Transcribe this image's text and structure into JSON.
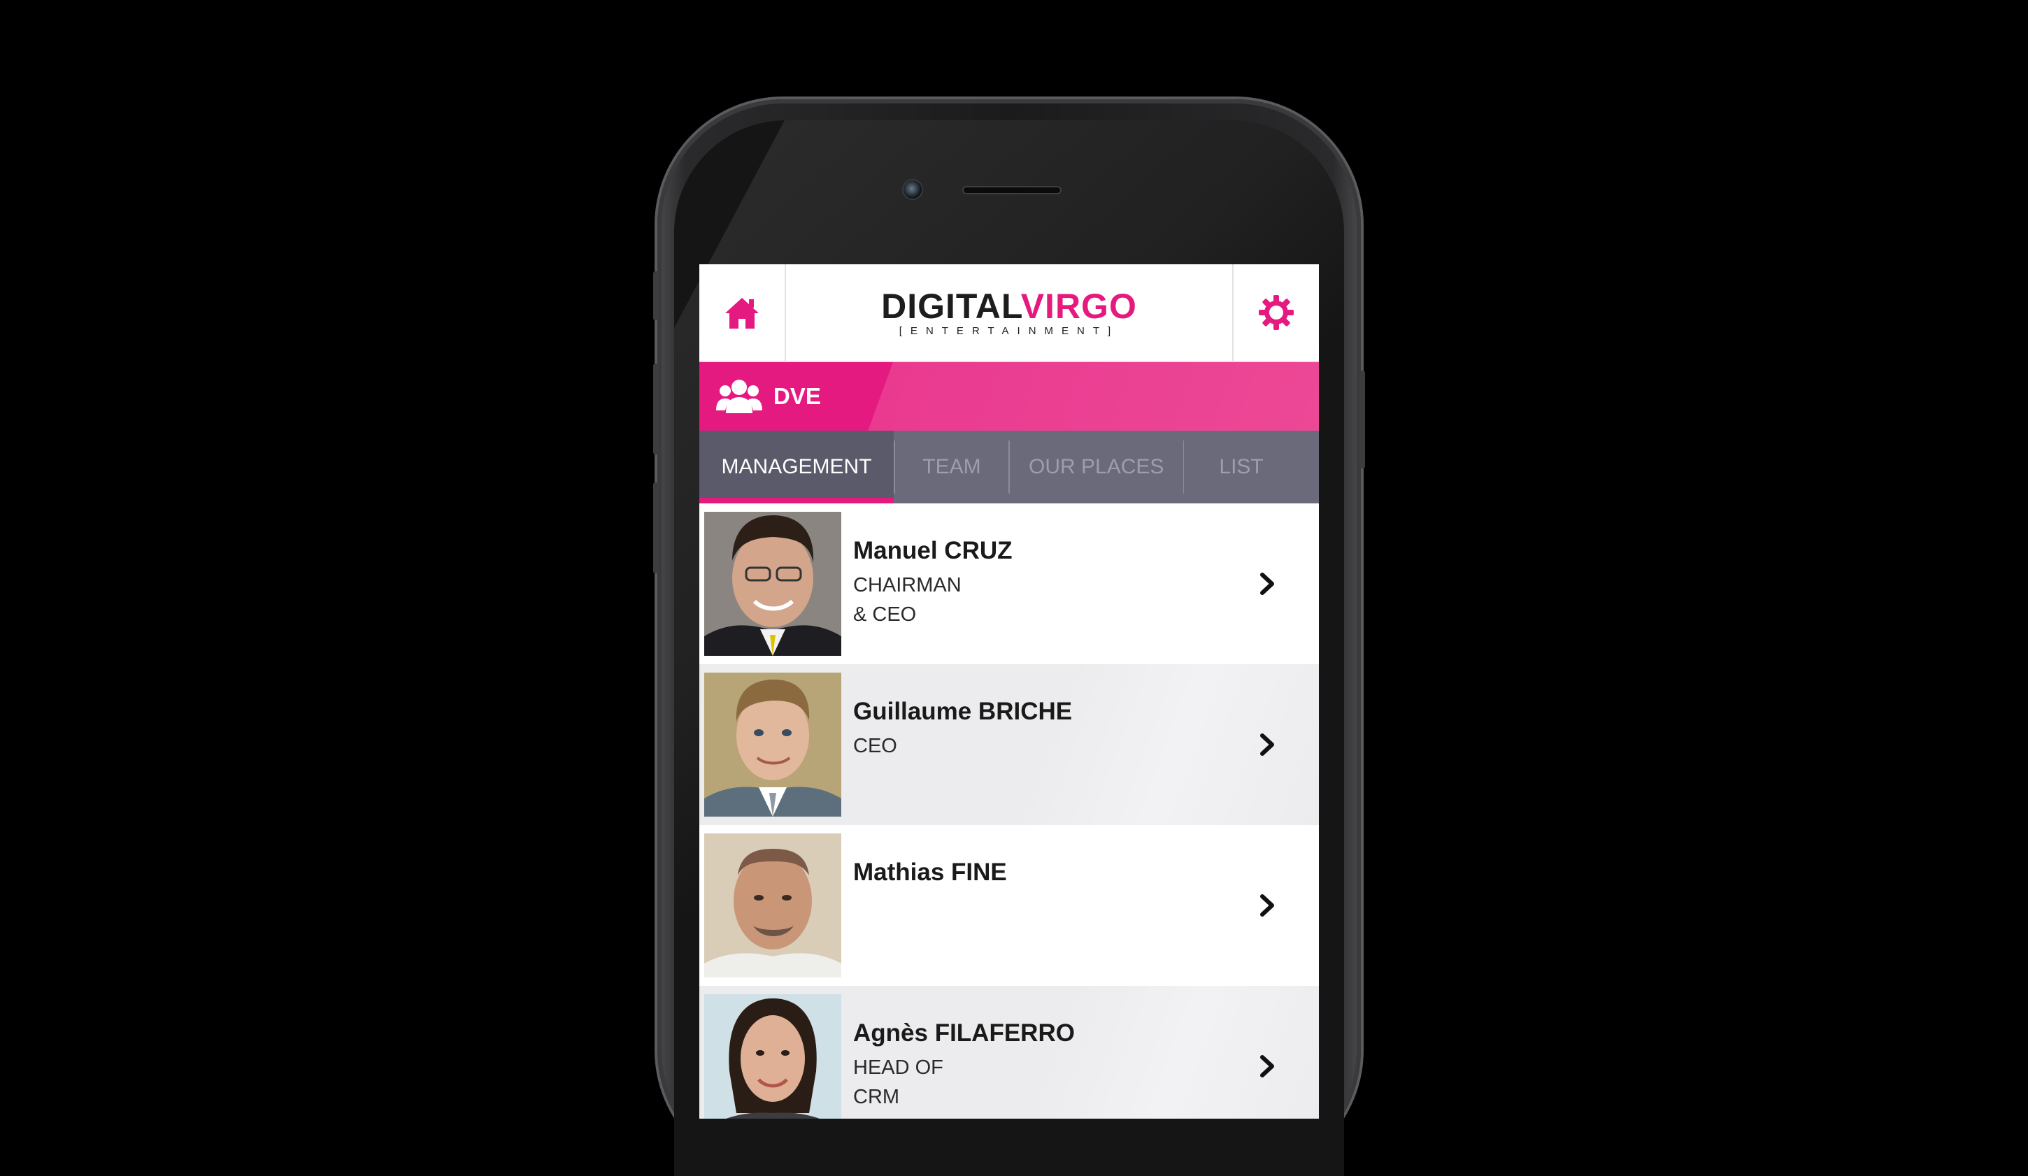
{
  "header": {
    "logo_primary": "DIGITAL",
    "logo_accent": "VIRGO",
    "logo_tagline": "[ENTERTAINMENT]",
    "home_icon": "home-icon",
    "settings_icon": "gear-icon"
  },
  "section": {
    "title": "DVE",
    "icon": "group-icon"
  },
  "tabs": [
    {
      "label": "MANAGEMENT",
      "active": true
    },
    {
      "label": "TEAM",
      "active": false
    },
    {
      "label": "OUR PLACES",
      "active": false
    },
    {
      "label": "LIST",
      "active": false
    }
  ],
  "people": [
    {
      "name": "Manuel CRUZ",
      "role_line1": "CHAIRMAN",
      "role_line2": "& CEO"
    },
    {
      "name": "Guillaume BRICHE",
      "role_line1": "CEO",
      "role_line2": ""
    },
    {
      "name": "Mathias FINE",
      "role_line1": "",
      "role_line2": ""
    },
    {
      "name": "Agnès FILAFERRO",
      "role_line1": "HEAD OF",
      "role_line2": "CRM"
    }
  ],
  "colors": {
    "accent": "#e51a81",
    "tab_bar": "#6a6a7a",
    "background": "#000000"
  }
}
